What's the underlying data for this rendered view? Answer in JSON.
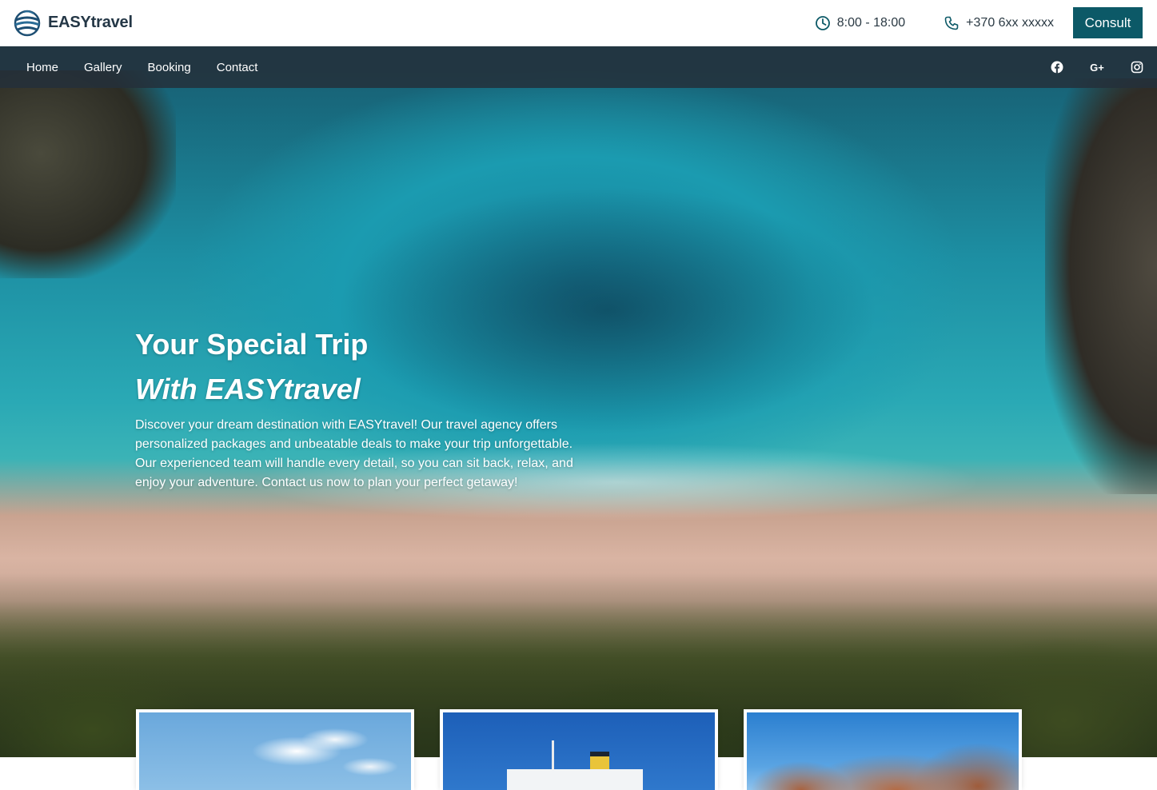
{
  "header": {
    "brand_name": "EASYtravel",
    "hours": "8:00 - 18:00",
    "phone": "+370 6xx xxxxx",
    "consult_label": "Consult"
  },
  "nav": {
    "items": [
      {
        "label": "Home"
      },
      {
        "label": "Gallery"
      },
      {
        "label": "Booking"
      },
      {
        "label": "Contact"
      }
    ],
    "socials": [
      {
        "icon": "facebook-icon"
      },
      {
        "icon": "google-plus-icon",
        "label": "G+"
      },
      {
        "icon": "instagram-icon"
      }
    ]
  },
  "hero": {
    "title": "Your Special Trip",
    "subtitle": "With EASYtravel",
    "description": "Discover your dream destination with EASYtravel! Our travel agency offers personalized packages and unbeatable deals to make your trip unforgettable. Our experienced team will handle every detail, so you can sit back, relax, and enjoy your adventure. Contact us now to plan your perfect getaway!"
  },
  "cards": [
    {
      "image": "sky-clouds"
    },
    {
      "image": "cruise-ship"
    },
    {
      "image": "desert-rocks"
    }
  ],
  "colors": {
    "accent": "#0c5967",
    "nav_background": "#24303a",
    "text_dark": "#243746"
  }
}
